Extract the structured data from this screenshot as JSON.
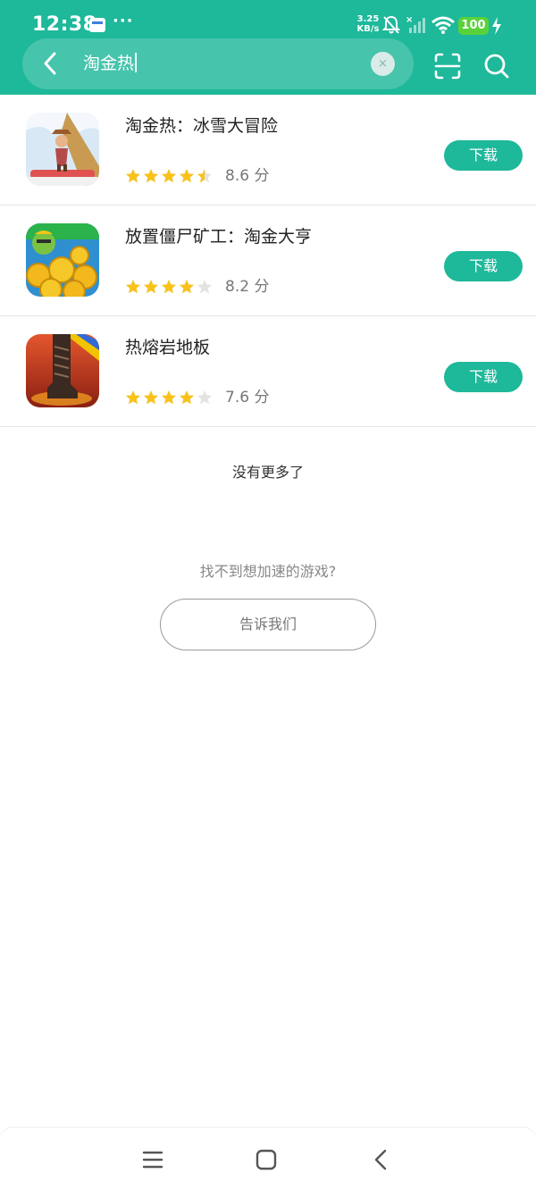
{
  "status_bar": {
    "time": "12:38",
    "more": "···",
    "net_speed_value": "3.25",
    "net_speed_unit": "KB/s",
    "battery": "100",
    "icons": [
      "calendar-notification-icon",
      "mute-icon",
      "cellular-no-signal-icon",
      "wifi-icon",
      "charging-icon"
    ]
  },
  "search": {
    "query": "淘金热",
    "clear_symbol": "×",
    "icons": [
      "back-arrow-icon",
      "clear-icon",
      "scan-icon",
      "search-icon"
    ]
  },
  "results": [
    {
      "name": "淘金热：冰雪大冒险",
      "rating": 4.5,
      "score": "8.6 分",
      "download_label": "下载"
    },
    {
      "name": "放置僵尸矿工：淘金大亨",
      "rating": 4,
      "score": "8.2 分",
      "download_label": "下载"
    },
    {
      "name": "热熔岩地板",
      "rating": 4,
      "score": "7.6 分",
      "download_label": "下载"
    }
  ],
  "footer": {
    "no_more": "没有更多了",
    "cant_find": "找不到想加速的游戏?",
    "tell_us": "告诉我们"
  },
  "colors": {
    "brand": "#1eb89a",
    "star_filled": "#f9c21a",
    "star_empty": "#e3e3e3",
    "battery": "#59d23a"
  },
  "nav_bar": {
    "icons": [
      "menu-icon",
      "home-icon",
      "back-icon"
    ]
  }
}
